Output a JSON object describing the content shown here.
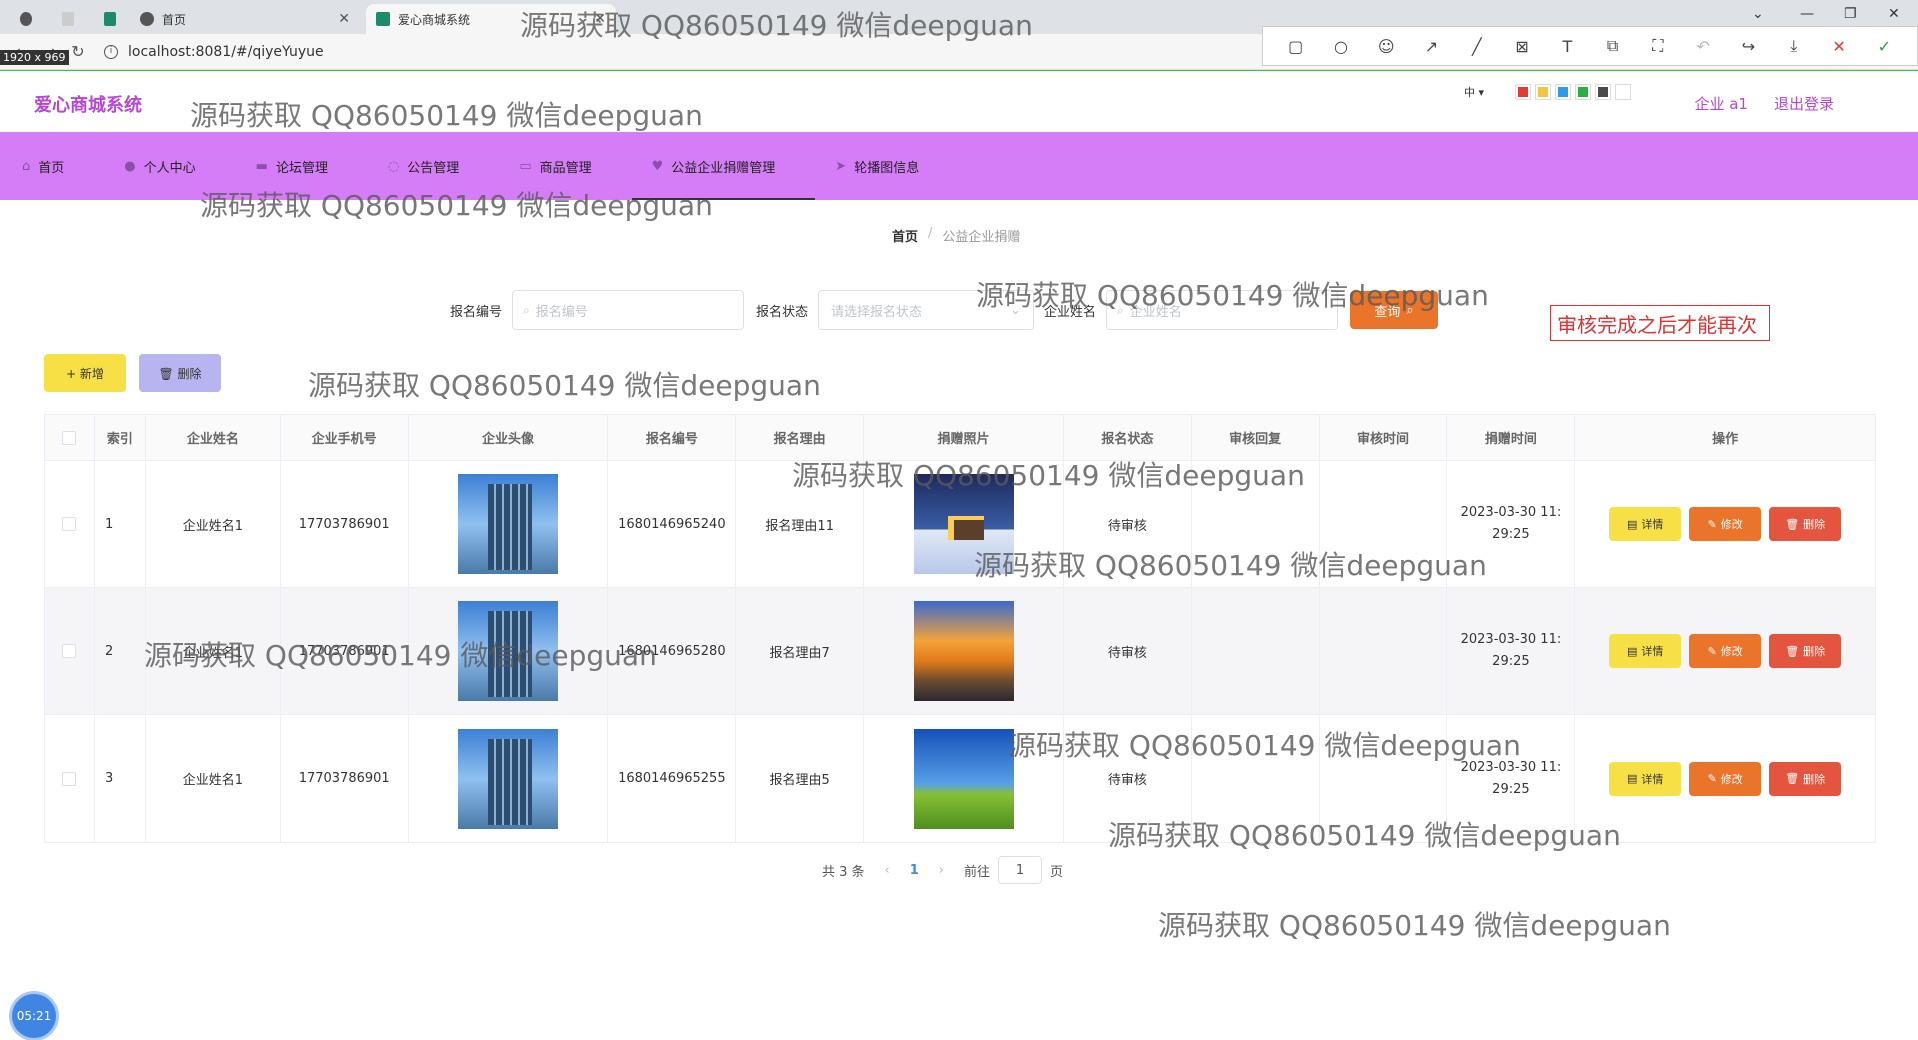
{
  "browser": {
    "tabs": [
      {
        "label": ""
      },
      {
        "label": ""
      },
      {
        "label": ""
      },
      {
        "label": "首页"
      },
      {
        "label": "爱心商城系统"
      }
    ],
    "url": "localhost:8081/#/qiyeYuyue",
    "dimension_label": "1920 x 969"
  },
  "app": {
    "brand": "爱心商城系统",
    "user_label": "企业 a1",
    "logout_label": "退出登录"
  },
  "snip_tool": {
    "size_select": "中 ▾",
    "colors": [
      "#e53935",
      "#f6c342",
      "#2f9be8",
      "#28b040",
      "#4a4a4a",
      "#ffffff"
    ]
  },
  "nav": {
    "items": [
      {
        "label": "首页",
        "icon": "home-icon"
      },
      {
        "label": "个人中心",
        "icon": "user-icon"
      },
      {
        "label": "论坛管理",
        "icon": "forum-icon"
      },
      {
        "label": "公告管理",
        "icon": "bell-icon"
      },
      {
        "label": "商品管理",
        "icon": "goods-icon"
      },
      {
        "label": "公益企业捐赠管理",
        "icon": "donate-icon"
      },
      {
        "label": "轮播图信息",
        "icon": "carousel-icon"
      }
    ]
  },
  "breadcrumb": {
    "home": "首页",
    "separator": "/",
    "current": "公益企业捐赠"
  },
  "search": {
    "field1_label": "报名编号",
    "field1_placeholder": "报名编号",
    "field2_label": "报名状态",
    "field2_placeholder": "请选择报名状态",
    "field3_label": "企业姓名",
    "field3_placeholder": "企业姓名",
    "query_label": "查询"
  },
  "notice": "审核完成之后才能再次",
  "actions": {
    "add_label": "+ 新增",
    "delete_label": "🗑 删除"
  },
  "table": {
    "headers": [
      "",
      "索引",
      "企业姓名",
      "企业手机号",
      "企业头像",
      "报名编号",
      "报名理由",
      "捐赠照片",
      "报名状态",
      "审核回复",
      "审核时间",
      "捐赠时间",
      "操作"
    ],
    "rows": [
      {
        "index": "1",
        "name": "企业姓名1",
        "phone": "17703786901",
        "avatar": "building",
        "code": "1680146965240",
        "reason": "报名理由11",
        "photo": "snow-cabin",
        "status": "待审核",
        "reply": "",
        "review_time": "",
        "time_line1": "2023-03-30 11:",
        "time_line2": "29:25"
      },
      {
        "index": "2",
        "name": "企业姓名1",
        "phone": "17703786901",
        "avatar": "building",
        "code": "1680146965280",
        "reason": "报名理由7",
        "photo": "sunset-beach",
        "status": "待审核",
        "reply": "",
        "review_time": "",
        "time_line1": "2023-03-30 11:",
        "time_line2": "29:25"
      },
      {
        "index": "3",
        "name": "企业姓名1",
        "phone": "17703786901",
        "avatar": "building",
        "code": "1680146965255",
        "reason": "报名理由5",
        "photo": "meadow-sky",
        "status": "待审核",
        "reply": "",
        "review_time": "",
        "time_line1": "2023-03-30 11:",
        "time_line2": "29:25"
      }
    ],
    "op_labels": {
      "detail": "详情",
      "edit": "修改",
      "remove": "删除"
    }
  },
  "pagination": {
    "total_label": "共 3 条",
    "current": "1",
    "goto_label": "前往",
    "page_value": "1",
    "page_suffix": "页"
  },
  "timer": "05:21",
  "watermark_text": "源码获取 QQ86050149 微信deepguan"
}
